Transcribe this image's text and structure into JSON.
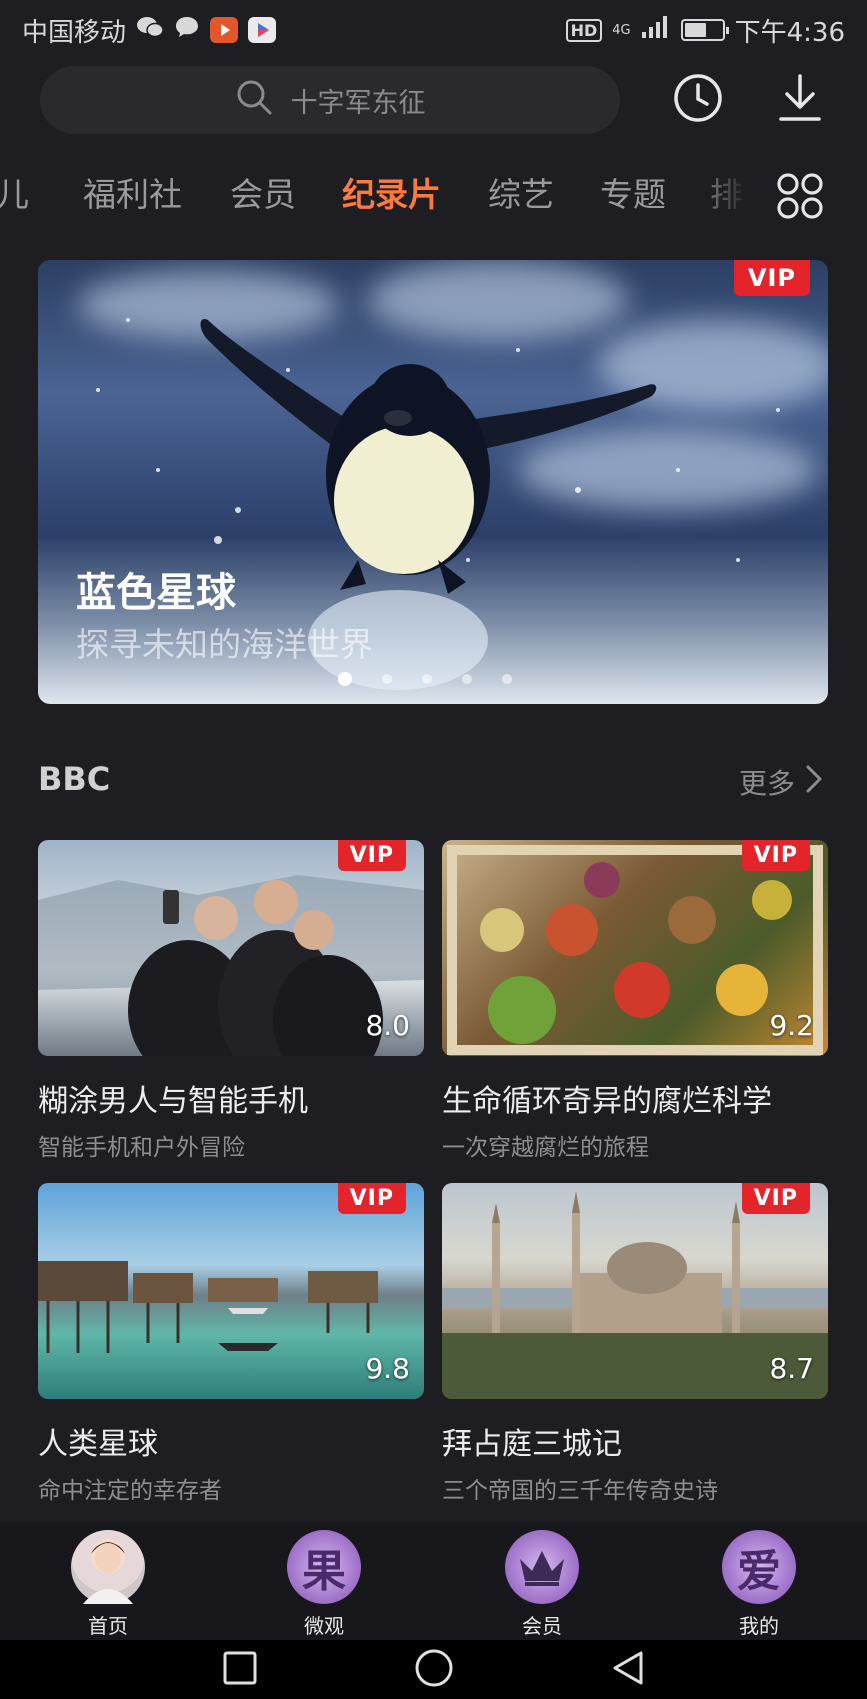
{
  "status": {
    "carrier": "中国移动",
    "hd": "HD",
    "net": "4G",
    "time": "下午4:36",
    "battery_level": 0.6
  },
  "search": {
    "placeholder": "十字军东征"
  },
  "tabs": [
    {
      "label": "儿"
    },
    {
      "label": "福利社"
    },
    {
      "label": "会员"
    },
    {
      "label": "纪录片",
      "active": true
    },
    {
      "label": "综艺"
    },
    {
      "label": "专题"
    },
    {
      "label": "排"
    }
  ],
  "banner": {
    "badge": "VIP",
    "title": "蓝色星球",
    "subtitle": "探寻未知的海洋世界",
    "slide_count": 5,
    "active_slide": 1
  },
  "section": {
    "title": "BBC",
    "more": "更多"
  },
  "cards": [
    {
      "badge": "VIP",
      "score": "8.0",
      "title": "糊涂男人与智能手机",
      "subtitle": "智能手机和户外冒险"
    },
    {
      "badge": "VIP",
      "score": "9.2",
      "title": "生命循环奇异的腐烂科学",
      "subtitle": "一次穿越腐烂的旅程"
    },
    {
      "badge": "VIP",
      "score": "9.8",
      "title": "人类星球",
      "subtitle": "命中注定的幸存者"
    },
    {
      "badge": "VIP",
      "score": "8.7",
      "title": "拜占庭三城记",
      "subtitle": "三个帝国的三千年传奇史诗"
    }
  ],
  "bottom_nav": [
    {
      "label": "首页",
      "icon": "avatar-icon"
    },
    {
      "label": "微观",
      "icon": "guo-icon",
      "glyph": "果"
    },
    {
      "label": "会员",
      "icon": "crown-icon"
    },
    {
      "label": "我的",
      "icon": "ai-icon",
      "glyph": "爱"
    }
  ],
  "colors": {
    "accent": "#ff7a3d",
    "vip": "#e3242b",
    "background": "#1e1e22"
  }
}
